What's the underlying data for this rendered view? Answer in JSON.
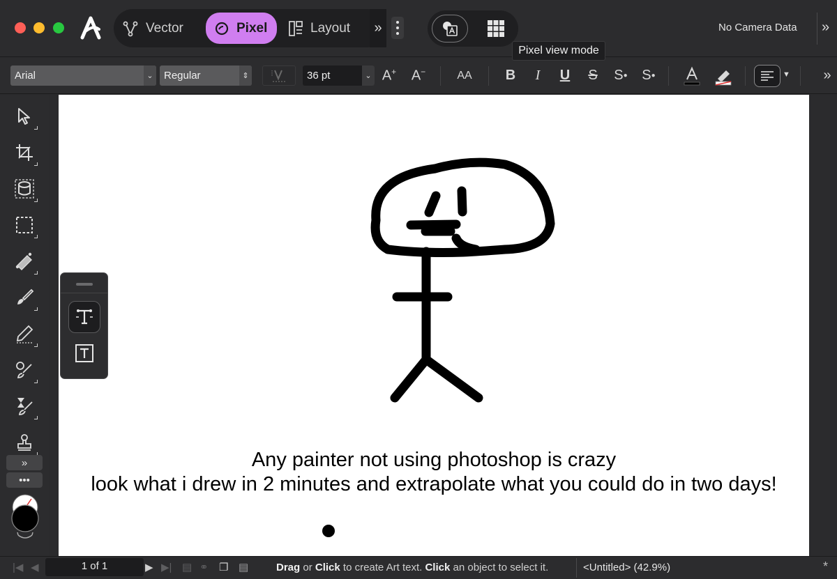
{
  "window": {
    "camera_text": "No Camera Data"
  },
  "personas": [
    {
      "label": "Vector",
      "active": false
    },
    {
      "label": "Pixel",
      "active": true
    },
    {
      "label": "Layout",
      "active": false
    }
  ],
  "tooltip": "Pixel view mode",
  "context_toolbar": {
    "font_family": "Arial",
    "font_style": "Regular",
    "font_size": "36 pt",
    "kern_icon": "kerning-icon",
    "increase_size_label": "A+",
    "decrease_size_label": "A-",
    "caps_label": "AA",
    "bold_label": "B",
    "italic_label": "I",
    "underline_label": "U",
    "strikethrough_label": "S",
    "superscript_label": "S",
    "subscript_label": "S"
  },
  "canvas": {
    "text_line_1": "Any painter not using photoshop is crazy",
    "text_line_2": "look what i drew in 2 minutes and extrapolate what you could do in two days!"
  },
  "statusbar": {
    "page_indicator": "1 of 1",
    "hint_drag": "Drag",
    "hint_or": " or ",
    "hint_click": "Click",
    "hint_mid": " to create Art text. ",
    "hint_click2": "Click",
    "hint_end": " an object to select it.",
    "doc_title": "<Untitled> (42.9%)",
    "modified_mark": "*"
  },
  "colors": {
    "pixel_persona_accent": "#d07ef0",
    "canvas_background": "#ffffff",
    "primary_color": "#000000"
  }
}
